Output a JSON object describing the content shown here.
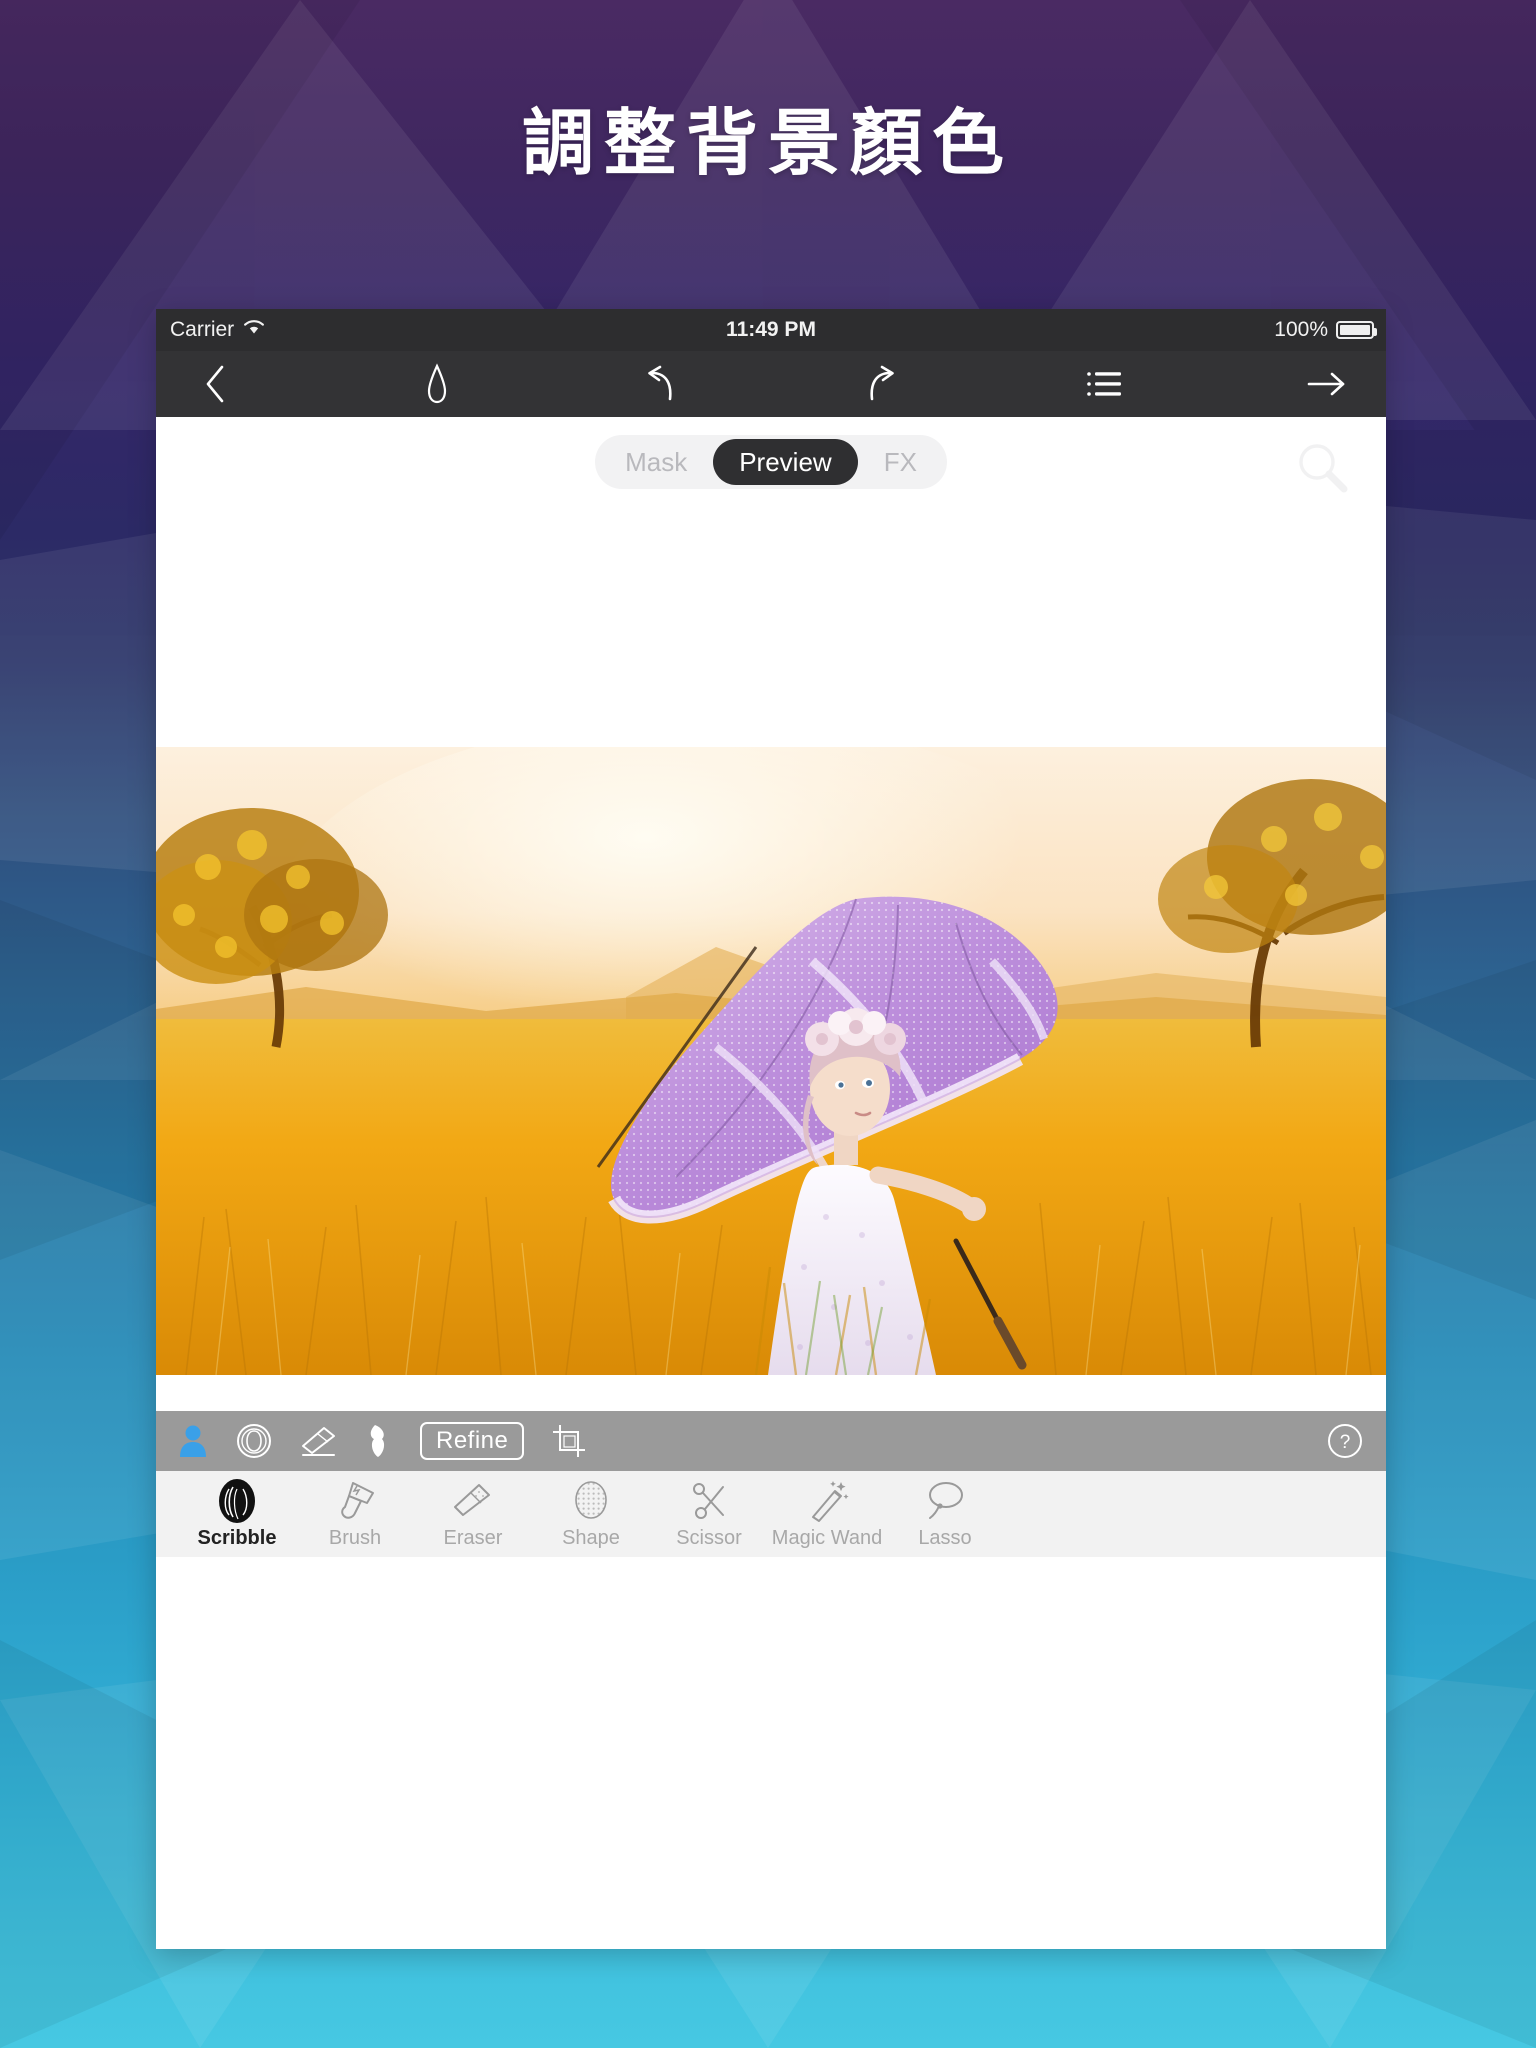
{
  "headline": {
    "text": "調整背景顏色"
  },
  "colors": {
    "bg_top": "#4a2a63",
    "bg_bottom": "#46c8e2",
    "statusbar_bg": "#2d2d2f",
    "navbar_bg": "#333335",
    "graybar_bg": "#9a9a9a",
    "accent_blue": "#3aa0e8",
    "segment_active_bg": "#2f2f31",
    "tooltabs_bg": "#f2f2f2"
  },
  "status_bar": {
    "carrier": "Carrier",
    "wifi_icon": "wifi-icon",
    "time": "11:49 PM",
    "battery_percent": "100%",
    "battery_icon": "battery-full-icon"
  },
  "nav_toolbar": {
    "items": [
      {
        "name": "back-chevron-icon",
        "label": "Back"
      },
      {
        "name": "droplet-icon",
        "label": "Color Drop"
      },
      {
        "name": "undo-icon",
        "label": "Undo"
      },
      {
        "name": "redo-icon",
        "label": "Redo"
      },
      {
        "name": "list-menu-icon",
        "label": "Layers"
      },
      {
        "name": "forward-arrow-icon",
        "label": "Next"
      }
    ]
  },
  "segmented_control": {
    "options": [
      "Mask",
      "Preview",
      "FX"
    ],
    "selected": "Preview",
    "zoom_icon": "magnifier-icon"
  },
  "photo": {
    "description": "Girl with purple lace umbrella in golden sunset field",
    "sky_color": "#fbe7cf",
    "field_color": "#f0a915",
    "umbrella_color": "#c49bdf",
    "dress_color": "#f2eaf4"
  },
  "gray_toolbar": {
    "items": [
      {
        "name": "portrait-person-icon",
        "label": "Portrait",
        "active": true
      },
      {
        "name": "face-circle-icon",
        "label": "Face"
      },
      {
        "name": "eraser-icon",
        "label": "Eraser"
      },
      {
        "name": "hair-brush-icon",
        "label": "Hair"
      },
      {
        "name": "crop-icon",
        "label": "Crop"
      }
    ],
    "refine_label": "Refine",
    "help_label": "?",
    "help_icon": "question-circle-icon"
  },
  "tool_tabs": {
    "items": [
      {
        "label": "Scribble",
        "icon": "scribble-icon",
        "active": true
      },
      {
        "label": "Brush",
        "icon": "brush-icon",
        "active": false
      },
      {
        "label": "Eraser",
        "icon": "eraser-icon",
        "active": false
      },
      {
        "label": "Shape",
        "icon": "shape-icon",
        "active": false
      },
      {
        "label": "Scissor",
        "icon": "scissor-icon",
        "active": false
      },
      {
        "label": "Magic Wand",
        "icon": "magic-wand-icon",
        "active": false
      },
      {
        "label": "Lasso",
        "icon": "lasso-icon",
        "active": false
      }
    ]
  }
}
